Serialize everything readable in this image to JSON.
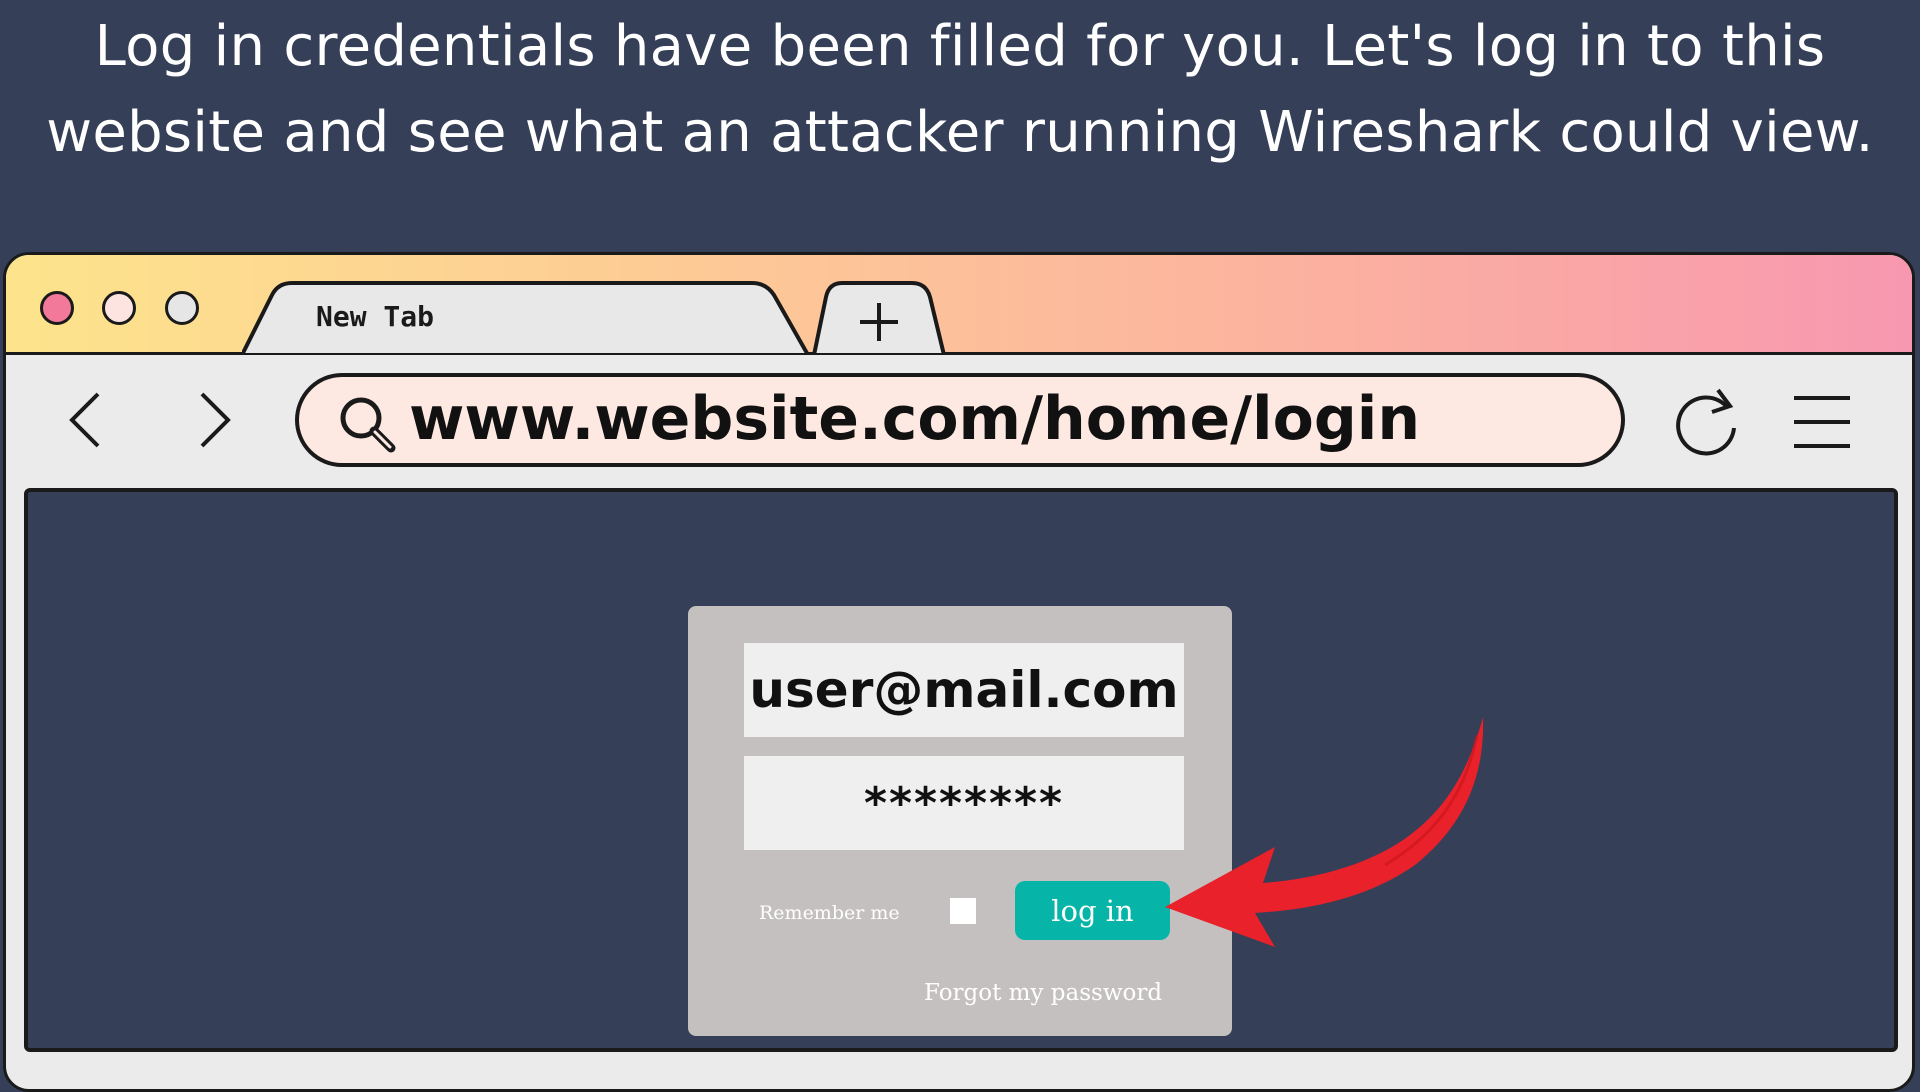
{
  "instruction": "Log in credentials have been filled for you. Let's log in to this website and see what an attacker running Wireshark could view.",
  "browser": {
    "tab_label": "New Tab",
    "new_tab_symbol": "+",
    "url": "www.website.com/home/login",
    "icons": [
      "back-arrow-icon",
      "forward-arrow-icon",
      "search-icon",
      "reload-icon",
      "hamburger-menu-icon",
      "plus-icon"
    ],
    "gradient_colors": [
      "#fde48c",
      "#fdc797",
      "#fbb0a0",
      "#f898b0"
    ]
  },
  "login_form": {
    "email": "user@mail.com",
    "password": "********",
    "remember_label": "Remember me",
    "remember_checked": false,
    "login_button": "log in",
    "forgot_link": "Forgot my password",
    "button_color": "#07b5a8"
  },
  "annotation": {
    "icon": "red-arrow-icon",
    "color": "#e8212a"
  }
}
